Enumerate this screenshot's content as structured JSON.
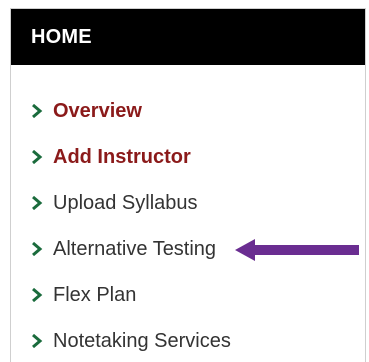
{
  "panel": {
    "title": "HOME"
  },
  "menu": {
    "items": [
      {
        "label": "Overview",
        "style": "bold-red",
        "icon": "chevron-right-icon"
      },
      {
        "label": "Add Instructor",
        "style": "bold-red",
        "icon": "chevron-right-icon"
      },
      {
        "label": "Upload Syllabus",
        "style": "normal",
        "icon": "chevron-right-icon"
      },
      {
        "label": "Alternative Testing",
        "style": "normal",
        "icon": "chevron-right-icon"
      },
      {
        "label": "Flex Plan",
        "style": "normal",
        "icon": "chevron-right-icon"
      },
      {
        "label": "Notetaking Services",
        "style": "normal",
        "icon": "chevron-right-icon"
      }
    ]
  },
  "colors": {
    "header_bg": "#000000",
    "header_text": "#ffffff",
    "chevron": "#1a6b3c",
    "bold_label": "#8b1a1a",
    "label": "#333333",
    "pointer_arrow": "#6a2d91"
  },
  "annotation": {
    "icon": "left-arrow-icon",
    "points_to": "Alternative Testing"
  }
}
